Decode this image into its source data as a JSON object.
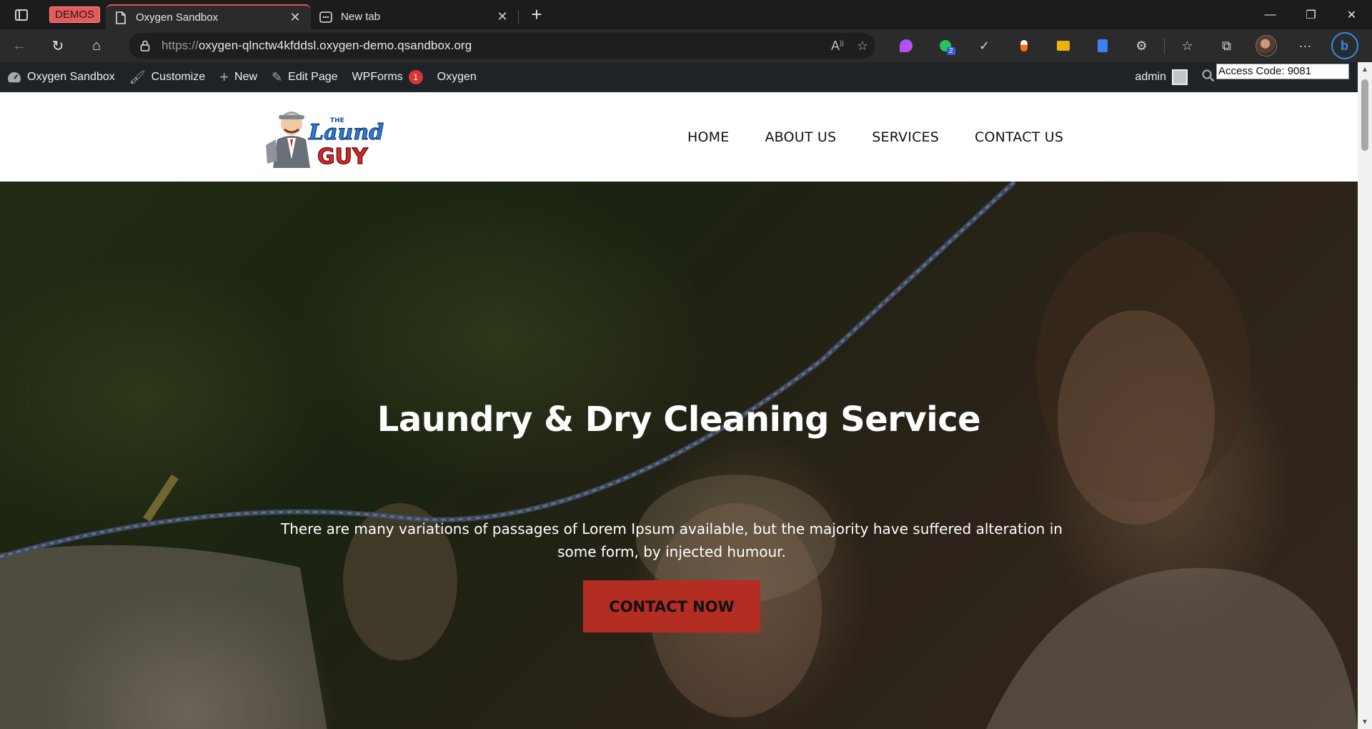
{
  "browser": {
    "tabs": [
      {
        "label": "Oxygen Sandbox",
        "active": true
      },
      {
        "label": "New tab",
        "active": false
      }
    ],
    "demos_badge": "DEMOS",
    "url_protocol": "https://",
    "url_host": "oxygen-qlnctw4kfddsl.oxygen-demo.qsandbox.org",
    "extension_badge_count": "2"
  },
  "adminbar": {
    "site_name": "Oxygen Sandbox",
    "customize": "Customize",
    "new": "New",
    "edit_page": "Edit Page",
    "wpforms": "WPForms",
    "wpforms_count": "1",
    "oxygen": "Oxygen",
    "user": "admin"
  },
  "access_code": "Access Code: 9081",
  "site": {
    "logo_text_top": "THE",
    "logo_text_main": "Laundry",
    "logo_text_bottom": "GUY",
    "nav": [
      "HOME",
      "ABOUT US",
      "SERVICES",
      "CONTACT US"
    ]
  },
  "hero": {
    "title": "Laundry & Dry Cleaning Service",
    "text": "There are many variations of passages of Lorem Ipsum available, but the majority have suffered alteration in some form, by injected humour.",
    "cta": "CONTACT NOW"
  },
  "colors": {
    "accent_red": "#b32d22",
    "admin_bar": "#1d2327",
    "tab_accent": "#e0505a"
  }
}
